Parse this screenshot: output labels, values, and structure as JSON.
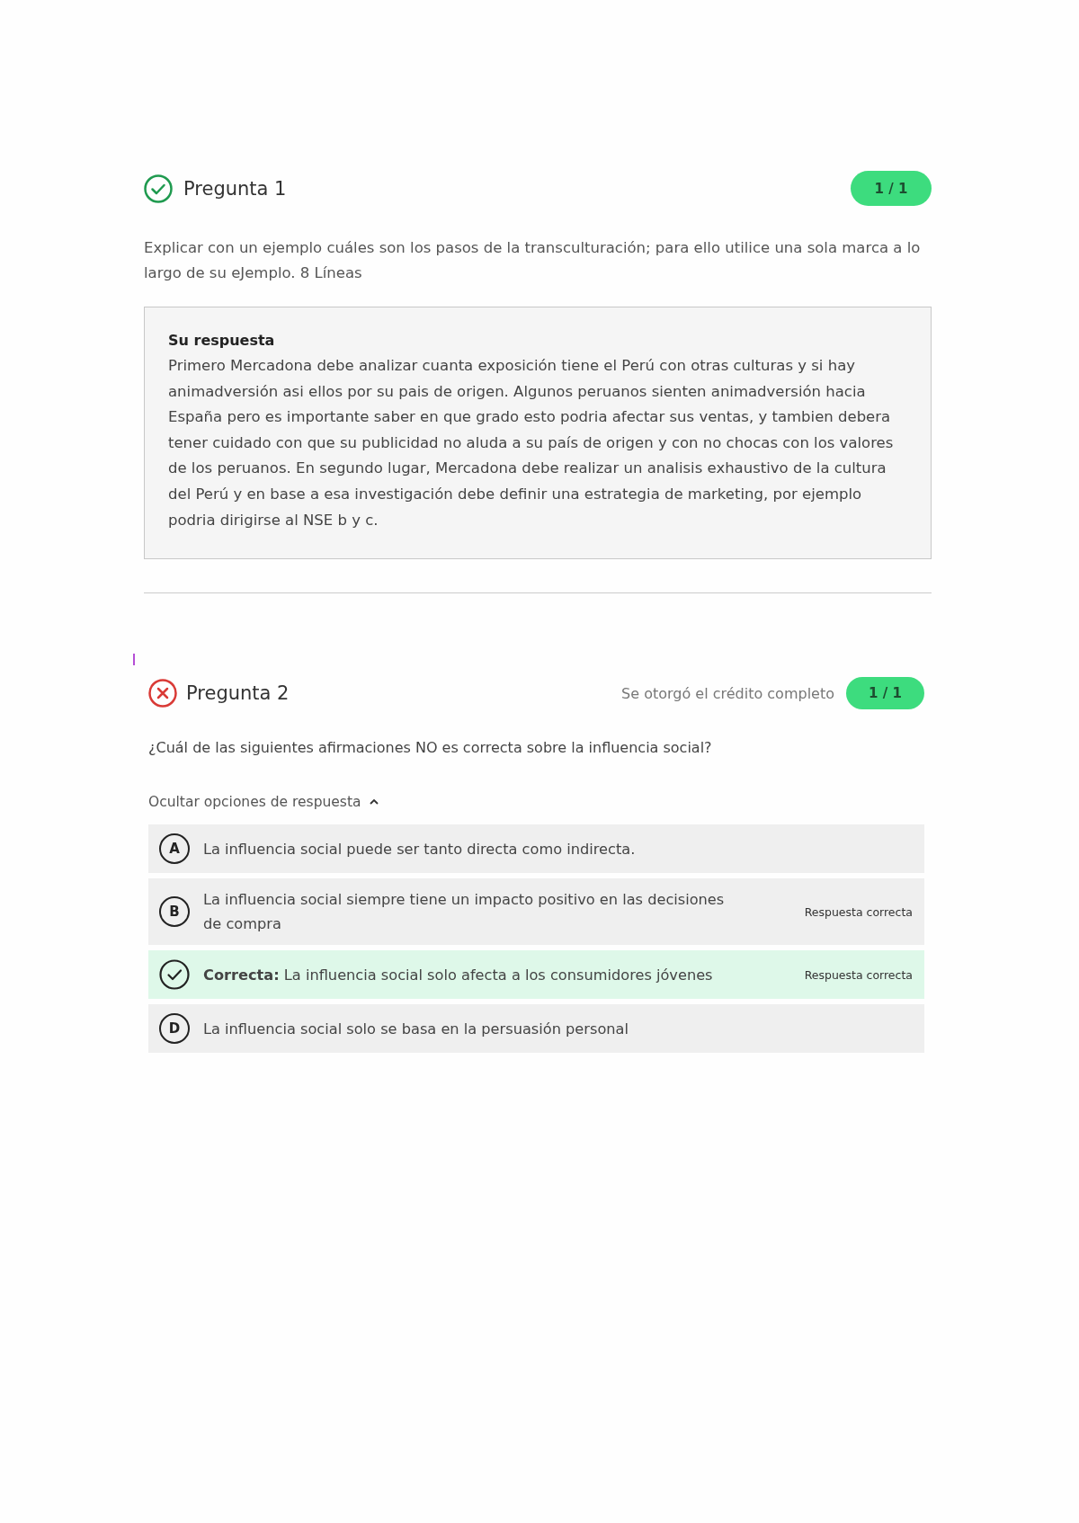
{
  "questions": [
    {
      "correct": true,
      "title": "Pregunta 1",
      "score": "1 / 1",
      "prompt": "Explicar con un ejemplo cuáles son los pasos de la transculturación; para ello utilice una sola marca a lo largo de su eJemplo. 8 Líneas",
      "response": {
        "heading": "Su respuesta",
        "text": "Primero Mercadona debe analizar cuanta exposición tiene el Perú con otras culturas y si hay animadversión asi ellos por su pais de origen. Algunos peruanos sienten animadversión hacia España pero es importante saber en que grado esto podria afectar sus ventas, y tambien debera tener cuidado con que su publicidad no aluda a su país de origen y con no chocas con los valores de los peruanos. En segundo lugar, Mercadona debe realizar un analisis exhaustivo de la cultura del Perú y en base a esa investigación debe definir una estrategia de marketing, por ejemplo podria dirigirse al NSE b y c."
      }
    },
    {
      "correct": false,
      "title": "Pregunta 2",
      "credit_note": "Se otorgó el crédito completo",
      "score": "1 / 1",
      "prompt": "¿Cuál de las siguientes afirmaciones NO es correcta sobre la influencia social?",
      "options_toggle": {
        "label": "Ocultar opciones de respuesta",
        "expanded": true
      },
      "options": [
        {
          "kind": "letter",
          "letter": "A",
          "text": "La influencia social puede ser tanto directa como indirecta.",
          "highlighted": false
        },
        {
          "kind": "letter",
          "letter": "B",
          "text": "La influencia social siempre tiene un impacto positivo en las decisiones de compra",
          "tag": "Respuesta correcta",
          "highlighted": false
        },
        {
          "kind": "check",
          "text": "**Correcta:** La influencia social solo afecta a los consumidores jóvenes",
          "tag": "Respuesta correcta",
          "highlighted": true
        },
        {
          "kind": "letter",
          "letter": "D",
          "text": "La influencia social solo se basa en la persuasión personal",
          "highlighted": false
        }
      ]
    }
  ]
}
